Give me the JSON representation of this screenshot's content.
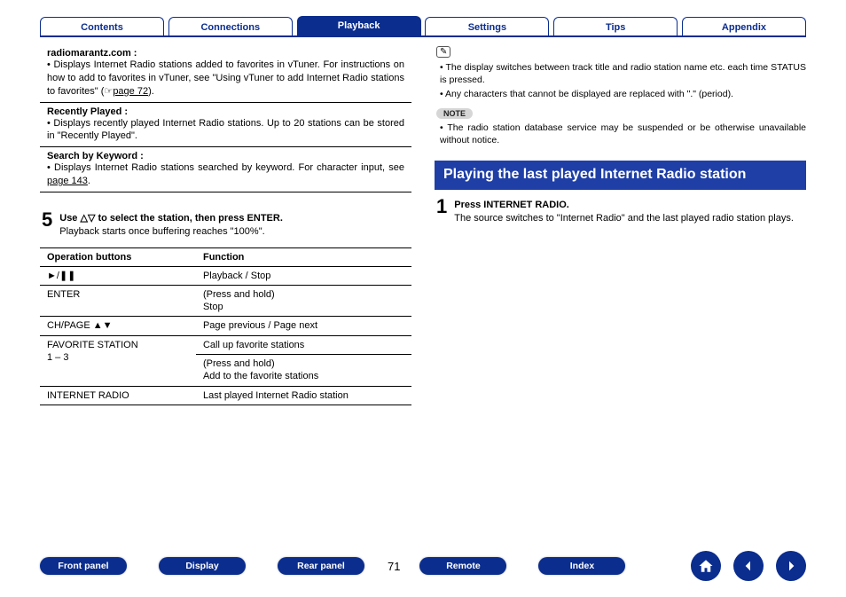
{
  "topnav": {
    "tabs": [
      {
        "label": "Contents"
      },
      {
        "label": "Connections"
      },
      {
        "label": "Playback"
      },
      {
        "label": "Settings"
      },
      {
        "label": "Tips"
      },
      {
        "label": "Appendix"
      }
    ],
    "active_index": 2
  },
  "left": {
    "entries": [
      {
        "label": "radiomarantz.com :",
        "text": "Displays Internet Radio stations added to favorites in vTuner. For instructions on how to add to favorites in vTuner, see \"Using vTuner to add Internet Radio stations to favorites\" (",
        "pageref_icon": "☞",
        "pageref": "page 72",
        "text_after": ")."
      },
      {
        "label": "Recently Played :",
        "text": "Displays recently played Internet Radio stations. Up to 20 stations can be stored in \"Recently Played\"."
      },
      {
        "label": "Search by Keyword :",
        "text": "Displays Internet Radio stations searched by keyword. For character input, see ",
        "pageref": "page 143",
        "text_after": "."
      }
    ],
    "step5": {
      "num": "5",
      "bold": "Use △▽ to select the station, then press ENTER.",
      "desc": "Playback starts once buffering reaches \"100%\"."
    },
    "table": {
      "headers": [
        "Operation buttons",
        "Function"
      ],
      "rows": [
        {
          "btn": "►/❚❚",
          "fn": "Playback / Stop"
        },
        {
          "btn": "ENTER",
          "fn": "(Press and hold)\nStop"
        },
        {
          "btn": "CH/PAGE ▲▼",
          "fn": "Page previous / Page next"
        },
        {
          "btn": "FAVORITE STATION\n1 – 3",
          "fn_a": "Call up favorite stations",
          "fn_b": "(Press and hold)\nAdd to the favorite stations",
          "split": true
        },
        {
          "btn": "INTERNET RADIO",
          "fn": "Last played Internet Radio station"
        }
      ]
    }
  },
  "right": {
    "pencil_icon": "✎",
    "tips": [
      "The display switches between track title and radio station name etc. each time STATUS is pressed.",
      "Any characters that cannot be displayed are replaced with \".\" (period)."
    ],
    "note_label": "NOTE",
    "notes": [
      "The radio station database service may be suspended or be otherwise unavailable without notice."
    ],
    "section_title": "Playing the last played Internet Radio station",
    "step1": {
      "num": "1",
      "bold": "Press INTERNET RADIO.",
      "desc": "The source switches to \"Internet Radio\" and the last played radio station plays."
    }
  },
  "footer": {
    "pills": [
      "Front panel",
      "Display",
      "Rear panel",
      "Remote",
      "Index"
    ],
    "page": "71"
  }
}
